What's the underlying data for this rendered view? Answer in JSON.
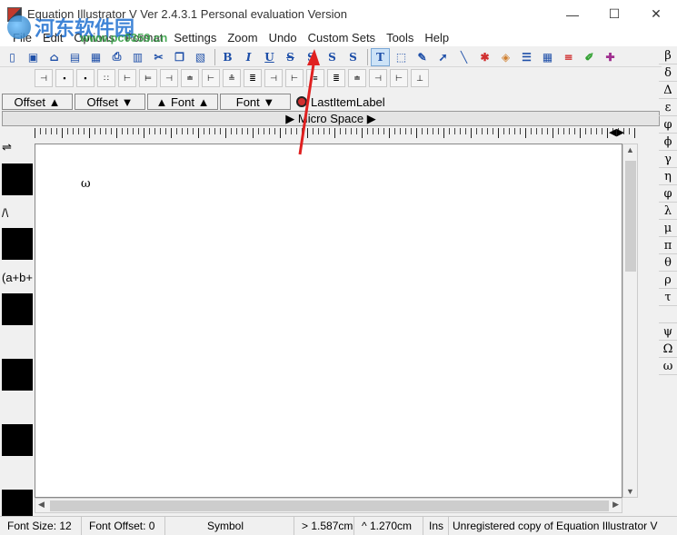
{
  "window": {
    "title": "Equation Illustrator V  Ver 2.4.3.1 Personal evaluation Version",
    "minimize": "—",
    "maximize": "☐",
    "close": "✕"
  },
  "watermark": {
    "cn": "河东软件园",
    "url": "www.pc0359.cn"
  },
  "menu": [
    "File",
    "Edit",
    "Options",
    "Format",
    "Settings",
    "Zoom",
    "Undo",
    "Custom Sets",
    "Tools",
    "Help"
  ],
  "toolbar": {
    "bold": "B",
    "italic": "I",
    "underline": "U",
    "strike": "S",
    "super": "S",
    "sub": "S",
    "both": "S",
    "text": "T"
  },
  "buttons": {
    "offset_up": "Offset ▲",
    "offset_down": "Offset ▼",
    "font_up": "▲ Font ▲",
    "font_down": "Font ▼",
    "last_item": "LastItemLabel",
    "micro_space": "▶ Micro Space ▶"
  },
  "canvas": {
    "glyph": "ω"
  },
  "left_palette": [
    "⇌",
    "/\\",
    "(a+b+"
  ],
  "right_palette": [
    "β",
    "δ",
    "Δ",
    "ε",
    "φ",
    "ϕ",
    "γ",
    "η",
    "φ",
    "λ",
    "μ",
    "π",
    "θ",
    "ρ",
    "τ",
    "",
    "ψ",
    "Ω",
    "ω"
  ],
  "status": {
    "font_size": "Font Size: 12",
    "font_offset": "Font Offset: 0",
    "font_name": "Symbol",
    "x": "> 1.587cm",
    "y": "^ 1.270cm",
    "mode": "Ins",
    "notice": "Unregistered copy of Equation Illustrator V"
  },
  "colors": {
    "accent": "#1e4fa8",
    "arrow": "#e02020"
  }
}
